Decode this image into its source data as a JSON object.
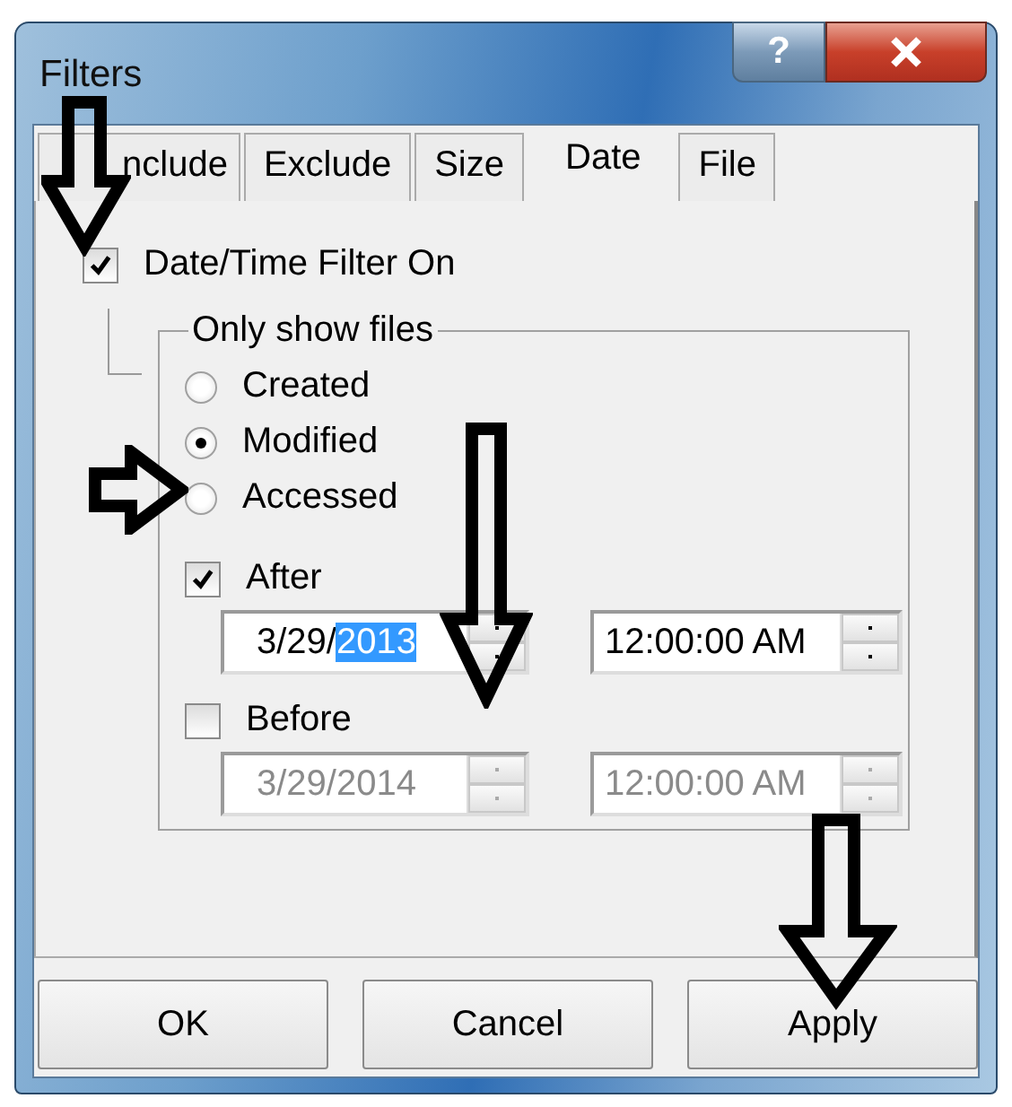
{
  "window": {
    "title": "Filters",
    "help_button": "?"
  },
  "tabs": [
    {
      "label": "nclude",
      "selected": false
    },
    {
      "label": "Exclude",
      "selected": false
    },
    {
      "label": "Size",
      "selected": false
    },
    {
      "label": "Date",
      "selected": true
    },
    {
      "label": "File",
      "selected": false
    }
  ],
  "filter_on": {
    "label": "Date/Time Filter On",
    "checked": true
  },
  "group": {
    "title": "Only show files",
    "options": [
      {
        "label": "Created",
        "selected": false
      },
      {
        "label": "Modified",
        "selected": true
      },
      {
        "label": "Accessed",
        "selected": false
      }
    ]
  },
  "ranges": [
    {
      "label": "After",
      "checked": true,
      "disabled": false,
      "date_parts": [
        {
          "text": "3/29/",
          "selected": false
        },
        {
          "text": "2013",
          "selected": true
        }
      ],
      "time": "12:00:00 AM"
    },
    {
      "label": "Before",
      "checked": false,
      "disabled": true,
      "date_parts": [
        {
          "text": "3/29/2014",
          "selected": false
        }
      ],
      "time": "12:00:00 AM"
    }
  ],
  "buttons": [
    {
      "label": "OK"
    },
    {
      "label": "Cancel"
    },
    {
      "label": "Apply"
    }
  ]
}
